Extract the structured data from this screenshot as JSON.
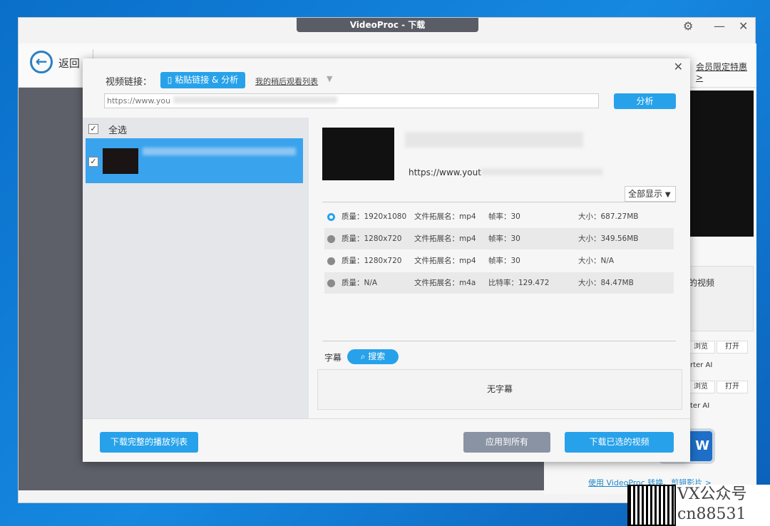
{
  "window": {
    "title": "VideoProc - 下载",
    "back_label": "返回",
    "promo_link": "会员限定特惠 >",
    "footer_link": "使用 VideoProc 转换、剪辑影片 >",
    "right_panel": {
      "text1": "的视频",
      "browse": "浏览",
      "open": "打开",
      "ai": "rter AI",
      "browse2": "浏览",
      "open2": "打开",
      "ai2": "ter AI",
      "now_btn": "W"
    }
  },
  "dialog": {
    "url_label": "视频链接：",
    "paste_btn": "粘贴链接 & 分析",
    "watch_later": "我的稍后观看列表",
    "url_value": "https://www.you",
    "analyze_btn": "分析",
    "select_all": "全选",
    "video_url": "https://www.yout",
    "show_all": "全部显示",
    "formats": [
      {
        "quality": "质量：1920x1080",
        "ext": "文件拓展名：mp4",
        "rate": "帧率：30",
        "size": "大小：687.27MB",
        "selected": true
      },
      {
        "quality": "质量：1280x720",
        "ext": "文件拓展名：mp4",
        "rate": "帧率：30",
        "size": "大小：349.56MB",
        "selected": false
      },
      {
        "quality": "质量：1280x720",
        "ext": "文件拓展名：mp4",
        "rate": "帧率：30",
        "size": "大小：N/A",
        "selected": false
      },
      {
        "quality": "质量：N/A",
        "ext": "文件拓展名：m4a",
        "rate": "比特率：129.472",
        "size": "大小：84.47MB",
        "selected": false
      }
    ],
    "subtitle_label": "字幕",
    "subtitle_search": "搜索",
    "no_subtitle": "无字幕",
    "download_playlist": "下载完整的播放列表",
    "apply_all": "应用到所有",
    "download_selected": "下载已选的视频"
  },
  "watermark": {
    "line1": "VX公众号",
    "line2": "cn88531"
  }
}
